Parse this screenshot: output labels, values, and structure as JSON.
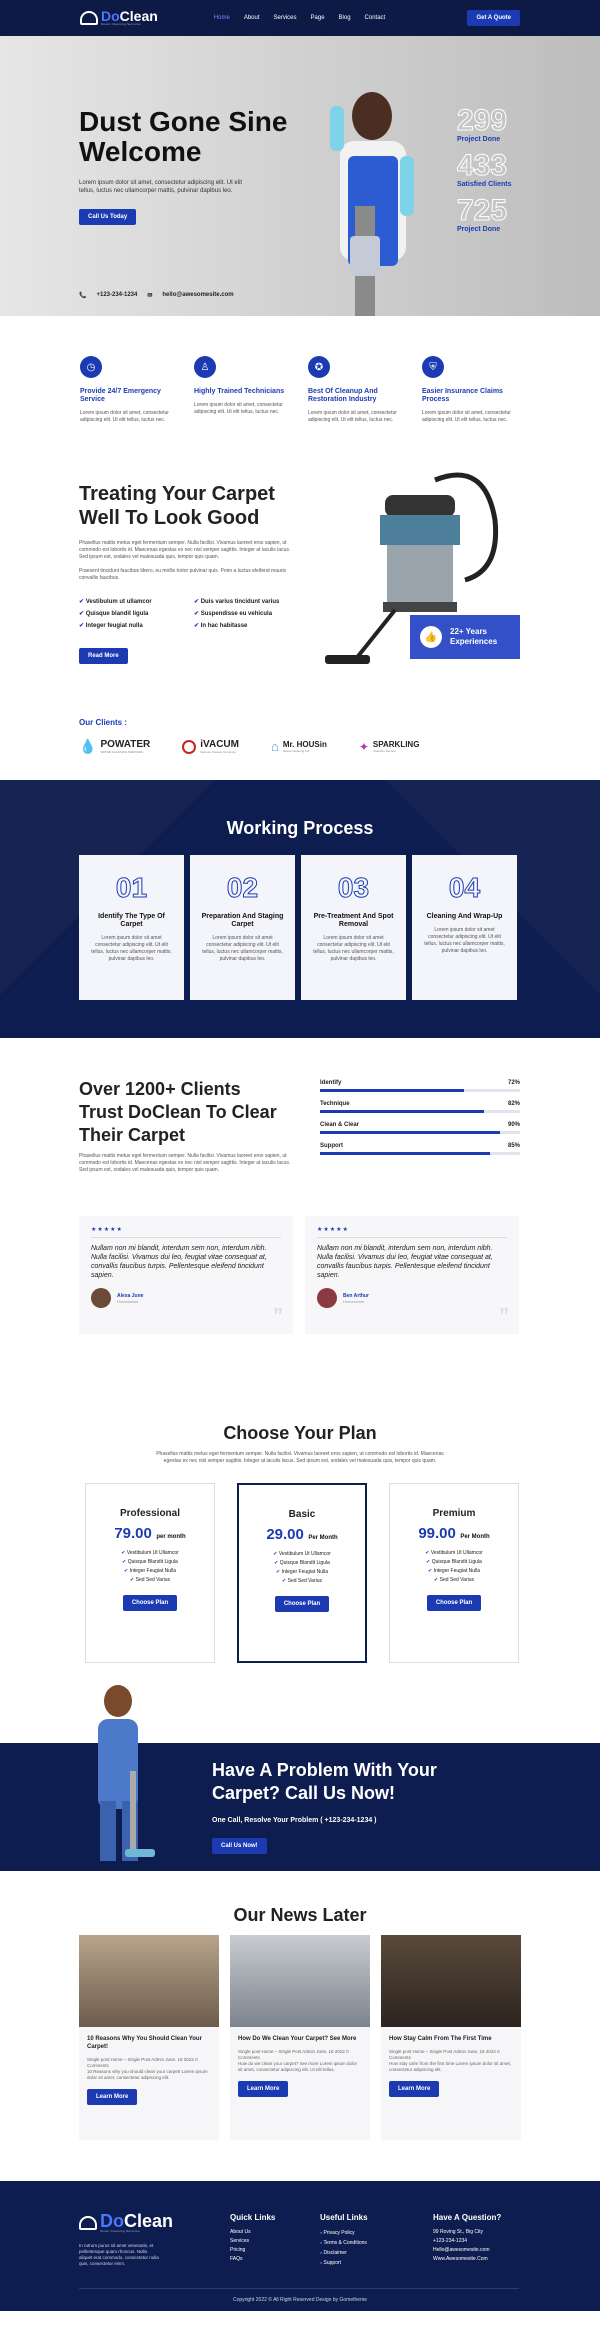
{
  "header": {
    "logo_do": "Do",
    "logo_clean": "Clean",
    "logo_sub": "Smart Cleaning Services",
    "nav": [
      "Home",
      "About",
      "Services",
      "Page",
      "Blog",
      "Contact"
    ],
    "cta": "Get A Quote"
  },
  "hero": {
    "title": "Dust Gone Sine Welcome",
    "desc": "Lorem ipsum dolor sit amet, consectetur adipiscing elit. Ut elit tellus, luctus nec ullamcorper mattis, pulvinar dapibus leo.",
    "button": "Call Us Today",
    "stats": [
      {
        "num": "299",
        "label": "Project Done"
      },
      {
        "num": "433",
        "label": "Satisfied Clients"
      },
      {
        "num": "725",
        "label": "Project Done"
      }
    ],
    "phone": "+123-234-1234",
    "email": "hello@awesomesite.com"
  },
  "features": [
    {
      "title": "Provide 24/7 Emergency Service",
      "desc": "Lorem ipsum dolor sit amet, consectetur adipiscing elit. Ut elit tellus, luctus nec."
    },
    {
      "title": "Highly Trained Technicians",
      "desc": "Lorem ipsum dolor sit amet, consectetur adipiscing elit. Ut elit tellus, luctus nec."
    },
    {
      "title": "Best Of Cleanup And Restoration Industry",
      "desc": "Lorem ipsum dolor sit amet, consectetur adipiscing elit. Ut elit tellus, luctus nec."
    },
    {
      "title": "Easier Insurance Claims Process",
      "desc": "Lorem ipsum dolor sit amet, consectetur adipiscing elit. Ut elit tellus, luctus nec."
    }
  ],
  "carpet": {
    "title": "Treating Your Carpet Well To Look Good",
    "p1": "Phasellus mattis metus eget fermentum semper. Nulla facilisi. Vivamus laoreet eros sapien, ut commodo est lobortis id. Maecenas egestas ex nec nisl semper sagittis. Integer at iaculis lacus. Sed ipsum est, sodales vel malesuada quis, tempor quis quam.",
    "p2": "Praesent tincidunt faucibus libero, eu mollis tortor pulvinar quis. Proin a luctus eleifend mauris convallis faucibus.",
    "checks": [
      "Vestibulum ut ullamcor",
      "Duis varius tincidunt varius",
      "Quisque blandit ligula",
      "Suspendisse eu vehicula",
      "Integer feugiat nulla",
      "In hac habitasse"
    ],
    "button": "Read More",
    "exp_line1": "22+ Years",
    "exp_line2": "Experiences",
    "clients_label": "Our Clients :",
    "clients": [
      {
        "name": "POWATER",
        "sub": "WATER CLEANING SERVICES"
      },
      {
        "name": "iVACUM",
        "sub": "Vacuum Cleaner Company"
      },
      {
        "name": "Mr. HOUSin",
        "sub": "House Cleaning Ltd"
      },
      {
        "name": "SPARKLING",
        "sub": "Cleaning Service"
      }
    ]
  },
  "process": {
    "title": "Working Process",
    "steps": [
      {
        "num": "01",
        "title": "Identify The Type Of Carpet",
        "desc": "Lorem ipsum dolor sit amet consectetur adipiscing elit. Ut elit tellus, luctus nec ullamcorper mattis, pulvinar dapibus leo."
      },
      {
        "num": "02",
        "title": "Preparation And Staging Carpet",
        "desc": "Lorem ipsum dolor sit amet consectetur adipiscing elit. Ut elit tellus, luctus nec ullamcorper mattis, pulvinar dapibus leo."
      },
      {
        "num": "03",
        "title": "Pre-Treatment And Spot Removal",
        "desc": "Lorem ipsum dolor sit amet consectetur adipiscing elit. Ut elit tellus, luctus nec ullamcorper mattis, pulvinar dapibus leo."
      },
      {
        "num": "04",
        "title": "Cleaning And Wrap-Up",
        "desc": "Lorem ipsum dolor sit amet consectetur adipiscing elit. Ut elit tellus, luctus nec ullamcorper mattis, pulvinar dapibus leo."
      }
    ]
  },
  "trust": {
    "title": "Over 1200+ Clients Trust DoClean To Clear Their Carpet",
    "desc": "Phasellus mattis metus eget fermentum semper. Nulla facilisi. Vivamus laoreet eros sapien, ut commodo est lobortis id. Maecenas egestas ex nec nisl semper sagittis. Integer at iaculis lacus. Sed ipsum est, sodales vel malesuada quis, tempor quis quam.",
    "skills": [
      {
        "label": "Identify",
        "value": "72%",
        "pct": 72
      },
      {
        "label": "Technique",
        "value": "82%",
        "pct": 82
      },
      {
        "label": "Clean & Clear",
        "value": "90%",
        "pct": 90
      },
      {
        "label": "Support",
        "value": "85%",
        "pct": 85
      }
    ],
    "testimonials": [
      {
        "stars": "★★★★★",
        "quote": "Nullam non mi blandit, interdum sem non, interdum nibh. Nulla facilisi. Vivamus dui leo, feugiat vitae consequat at, convallis faucibus turpis. Pellentesque eleifend tincidunt sapien.",
        "name": "Alexa June",
        "role": "Homeowner"
      },
      {
        "stars": "★★★★★",
        "quote": "Nullam non mi blandit, interdum sem non, interdum nibh. Nulla facilisi. Vivamus dui leo, feugiat vitae consequat at, convallis faucibus turpis. Pellentesque eleifend tincidunt sapien.",
        "name": "Ben Arthur",
        "role": "Homeowner"
      }
    ]
  },
  "plans": {
    "title": "Choose Your Plan",
    "desc": "Phasellus mattis metus eget fermentum semper. Nulla facilisi. Vivamus laoreet eros sapien, ut commodo est lobortis id. Maecenas egestas ex nec nisl semper sagittis. Integer at iaculis lacus. Sed ipsum est, sodales vel malesuada quis, tempor quis quam.",
    "items": [
      {
        "name": "Professional",
        "price": "79.00",
        "per": "per month",
        "features": [
          "Vestibulum Ut Ullamcor",
          "Quisque Blandit Ligula",
          "Integer Feugiat Nulla",
          "Sed Sed Varius"
        ],
        "button": "Choose Plan"
      },
      {
        "name": "Basic",
        "price": "29.00",
        "per": "Per Month",
        "features": [
          "Vestibulum Ut Ullamcor",
          "Quisque Blandit Ligula",
          "Integer Feugiat Nulla",
          "Sed Sed Varius"
        ],
        "button": "Choose Plan"
      },
      {
        "name": "Premium",
        "price": "99.00",
        "per": "Per Month",
        "features": [
          "Vestibulum Ut Ullamcor",
          "Quisque Blandit Ligula",
          "Integer Feugiat Nulla",
          "Sed Sed Varius"
        ],
        "button": "Choose Plan"
      }
    ]
  },
  "cta": {
    "title": "Have A Problem With Your Carpet? Call Us Now!",
    "sub": "One Call, Resolve Your Problem ( +123-234-1234 )",
    "button": "Call Us Now!"
  },
  "news": {
    "title": "Our News Later",
    "items": [
      {
        "title": "10 Reasons Why You Should Clean Your Carpet!",
        "meta": "Single post Home – Single Post Admin June, 18 2022 0 Comments",
        "desc": "10 Reasons why you should clean your carpet! Lorem ipsum dolor sit amet, consectetur adipiscing elit.",
        "button": "Learn More"
      },
      {
        "title": "How Do We Clean Your Carpet? See More",
        "meta": "Single post Home – Single Post Admin June, 18 2022 0 Comments",
        "desc": "How do we clean your carpet? see more Lorem ipsum dolor sit amet, consectetur adipiscing elit. Ut elit tellus.",
        "button": "Learn More"
      },
      {
        "title": "How Stay Calm From The First Time",
        "meta": "Single post Home – Single Post Admin June, 18 2022 0 Comments",
        "desc": "How stay calm from the first time Lorem ipsum dolor sit amet, consectetur adipiscing elit.",
        "button": "Learn More"
      }
    ]
  },
  "footer": {
    "logo_do": "Do",
    "logo_clean": "Clean",
    "logo_sub": "Smart Cleaning Services",
    "desc": "In rutrum purus sit amet venenatis, et pellentesque quam rhoncus. Nulla aliquet erat commodo, consectetur nulla quis, consectetur enim.",
    "quick_title": "Quick Links",
    "quick": [
      "About Us",
      "Services",
      "Pricing",
      "FAQs"
    ],
    "useful_title": "Useful Links",
    "useful": [
      "Privacy Policy",
      "Terms & Conditions",
      "Disclaimer",
      "Support"
    ],
    "question_title": "Have A Question?",
    "question": [
      "99 Roving St., Big City",
      "+123-234-1234",
      "Hello@awesomesite.com",
      "Www.Awesomesite.Com"
    ],
    "copyright": "Copyright 2022 © All Right Reserved Design by Gomethemе"
  }
}
